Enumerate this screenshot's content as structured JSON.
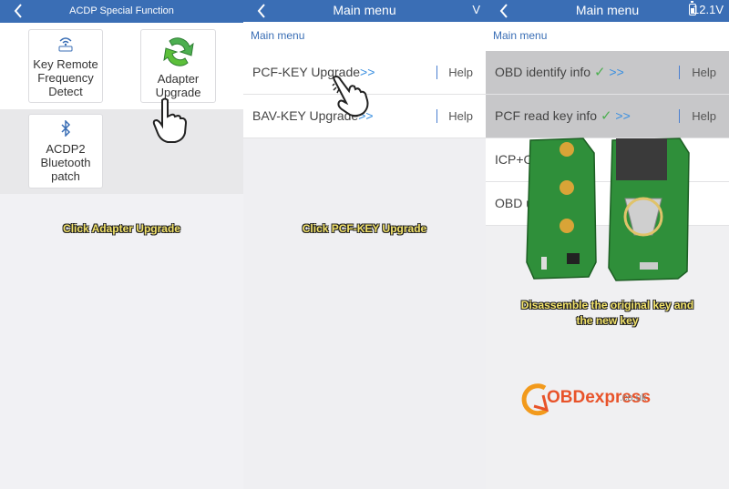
{
  "panel1": {
    "title": "ACDP Special Function",
    "tiles": [
      {
        "label": "Key Remote Frequency Detect"
      },
      {
        "label": "Adapter Upgrade"
      },
      {
        "label": "ACDP2 Bluetooth patch"
      }
    ],
    "caption": "Click Adapter Upgrade"
  },
  "panel2": {
    "title": "Main menu",
    "title_right": "V",
    "breadcrumb": "Main menu",
    "rows": [
      {
        "label": "PCF-KEY Upgrade",
        "arrow": ">>",
        "help": "Help"
      },
      {
        "label": "BAV-KEY Upgrade",
        "arrow": ">>",
        "help": "Help"
      }
    ],
    "caption": "Click PCF-KEY Upgrade"
  },
  "panel3": {
    "title": "Main menu",
    "voltage": "12.1V",
    "breadcrumb": "Main menu",
    "rows": [
      {
        "label": "OBD identify info",
        "check": "✓",
        "arrow": ">>",
        "help": "Help"
      },
      {
        "label": "PCF read key info",
        "check": "✓",
        "arrow": ">>",
        "help": "Help"
      },
      {
        "label": "ICP+OF"
      },
      {
        "label": "OBD u"
      }
    ],
    "caption_line1": "Disassemble the original key and",
    "caption_line2": "the new key",
    "logo_brand": "OBDexpress",
    "logo_domain": ".co.uk"
  },
  "colors": {
    "header": "#3a6eb5",
    "link": "#3a8fe0",
    "check": "#4caf50",
    "caption": "#f2e26a"
  }
}
